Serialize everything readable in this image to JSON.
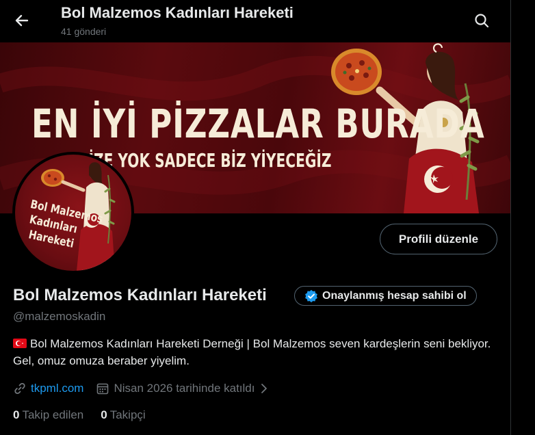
{
  "header": {
    "title": "Bol Malzemos Kadınları Hareketi",
    "post_count": "41 gönderi"
  },
  "banner": {
    "headline": "EN İYİ PİZZALAR BURADA",
    "subline": "SİZE YOK SADECE BİZ YİYECEĞİZ"
  },
  "avatar": {
    "logo_text": [
      "Bol Malzemos",
      "Kadınları",
      "Hareketi"
    ]
  },
  "profile": {
    "edit_button": "Profili düzenle",
    "name": "Bol Malzemos Kadınları Hareketi",
    "verify_button": "Onaylanmış hesap sahibi ol",
    "handle": "@malzemoskadin",
    "bio": "Bol Malzemos Kadınları Hareketi Derneği | Bol Malzemos seven kardeşlerin seni bekliyor. Gel, omuz omuza beraber yiyelim.",
    "website": "tkpml.com",
    "joined": "Nisan 2026 tarihinde katıldı",
    "following_count": "0",
    "following_label": "Takip edilen",
    "followers_count": "0",
    "followers_label": "Takipçi"
  },
  "icons": {
    "back": "arrow-left-icon",
    "search": "search-icon",
    "verified": "verified-badge-icon",
    "link": "link-icon",
    "calendar": "calendar-icon",
    "chevron": "chevron-right-icon",
    "flag": "turkey-flag-icon"
  },
  "colors": {
    "background": "#000000",
    "text": "#e7e9ea",
    "muted": "#71767b",
    "link": "#1d9bf0",
    "border": "#536471",
    "banner_red": "#5a0a0e",
    "flag_red": "#e30a17"
  }
}
